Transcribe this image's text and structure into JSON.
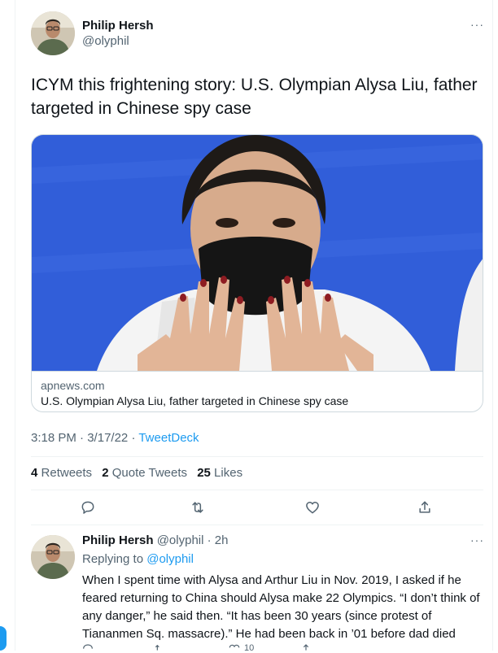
{
  "main_tweet": {
    "author_name": "Philip Hersh",
    "author_handle": "@olyphil",
    "more": "···",
    "text": "ICYM this frightening story:  U.S. Olympian Alysa Liu, father targeted in Chinese spy case",
    "card": {
      "domain": "apnews.com",
      "title": "U.S. Olympian Alysa Liu, father targeted in Chinese spy case"
    },
    "time": "3:18 PM",
    "date": "3/17/22",
    "source": "TweetDeck",
    "sep": "·",
    "stats": {
      "retweets_count": "4",
      "retweets_label": "Retweets",
      "quotes_count": "2",
      "quotes_label": "Quote Tweets",
      "likes_count": "25",
      "likes_label": "Likes"
    }
  },
  "reply_tweet": {
    "author_name": "Philip Hersh",
    "author_handle": "@olyphil",
    "age": "· 2h",
    "more": "···",
    "replying_prefix": "Replying to",
    "replying_to": "@olyphil",
    "text": "When I spent time with Alysa and Arthur Liu in Nov. 2019, I asked if he feared returning to China should Alysa make 22 Olympics. “I don’t think of any danger,” he said then.  “It has been 30 years (since protest of Tiananmen Sq. massacre).” He had been back in ’01 before dad died",
    "like_count": "10"
  },
  "colors": {
    "accent": "#1d9bf0",
    "secondary_text": "#536471",
    "border": "#cfd9de"
  },
  "icons": [
    "reply-icon",
    "retweet-icon",
    "like-icon",
    "share-icon",
    "more-icon"
  ]
}
